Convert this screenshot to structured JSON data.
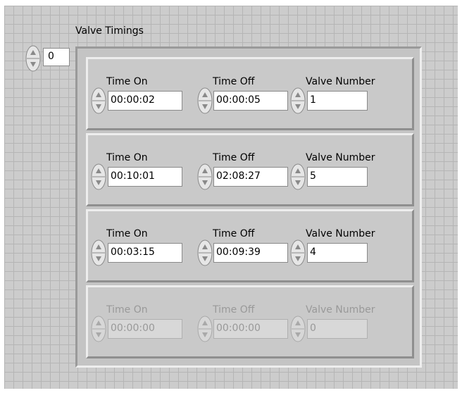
{
  "array": {
    "label": "Valve Timings",
    "index": "0"
  },
  "clusters": [
    {
      "time_on_label": "Time On",
      "time_off_label": "Time Off",
      "valve_number_label": "Valve Number",
      "time_on": "00:00:02",
      "time_off": "00:00:05",
      "valve_number": "1",
      "disabled": false
    },
    {
      "time_on_label": "Time On",
      "time_off_label": "Time Off",
      "valve_number_label": "Valve Number",
      "time_on": "00:10:01",
      "time_off": "02:08:27",
      "valve_number": "5",
      "disabled": false
    },
    {
      "time_on_label": "Time On",
      "time_off_label": "Time Off",
      "valve_number_label": "Valve Number",
      "time_on": "00:03:15",
      "time_off": "00:09:39",
      "valve_number": "4",
      "disabled": false
    },
    {
      "time_on_label": "Time On",
      "time_off_label": "Time Off",
      "valve_number_label": "Valve Number",
      "time_on": "00:00:00",
      "time_off": "00:00:00",
      "valve_number": "0",
      "disabled": true
    }
  ]
}
